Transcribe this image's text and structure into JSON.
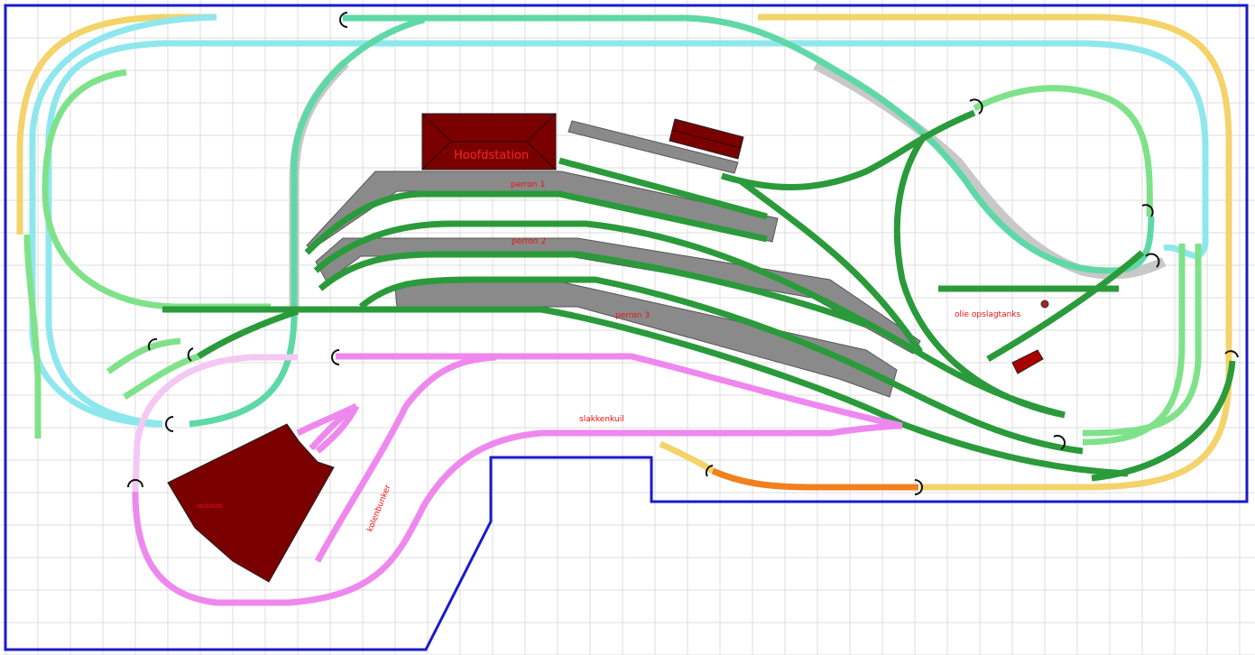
{
  "labels": {
    "station": "Hoofdstation",
    "perron1": "perron 1",
    "perron2": "perron 2",
    "perron3": "perron 3",
    "slakkenkuil": "slakkenkuil",
    "olie": "olie opslagtanks",
    "locloods": "locloods",
    "kolenbunker": "kolenbunker"
  },
  "colors": {
    "grid": "#dcdcdc",
    "border": "#1a1acc",
    "track_green": "#2a9a3a",
    "track_light_green": "#7fe28a",
    "track_cyan": "#8fe7ee",
    "track_teal": "#5fd8a8",
    "track_yellow": "#f3d36a",
    "track_pink": "#ee88ee",
    "track_light_pink": "#f3c8f3",
    "track_orange": "#f08020",
    "platform": "#8a8a8a",
    "building": "#7a0000",
    "label": "#ee1111"
  }
}
